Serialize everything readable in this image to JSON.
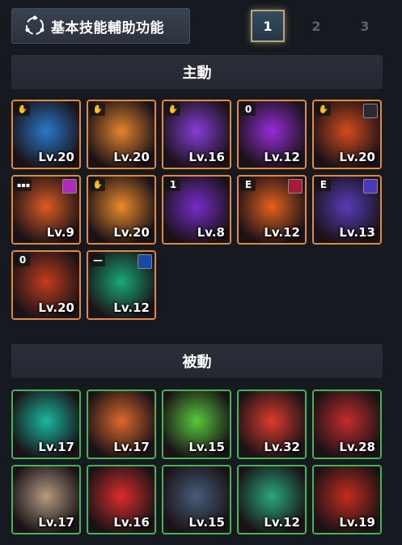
{
  "header": {
    "title": "基本技能輔助功能",
    "pages": [
      "1",
      "2",
      "3"
    ],
    "active_page": "1"
  },
  "active_section": {
    "title": "主動",
    "skills": [
      {
        "level": "Lv.20",
        "badge": "hand",
        "corner": "",
        "theme": "#2a78c8"
      },
      {
        "level": "Lv.20",
        "badge": "hand",
        "corner": "",
        "theme": "#e8842a"
      },
      {
        "level": "Lv.16",
        "badge": "hand",
        "corner": "",
        "theme": "#8a3ad8"
      },
      {
        "level": "Lv.12",
        "badge": "0",
        "corner": "",
        "theme": "#9a2ad8"
      },
      {
        "level": "Lv.20",
        "badge": "hand",
        "corner": "dark",
        "theme": "#d84a1a"
      },
      {
        "level": "Lv.9",
        "badge": "dots",
        "corner": "magenta",
        "theme": "#e05a20"
      },
      {
        "level": "Lv.20",
        "badge": "hand",
        "corner": "",
        "theme": "#f08a2a"
      },
      {
        "level": "Lv.8",
        "badge": "1",
        "corner": "",
        "theme": "#7a2ac8"
      },
      {
        "level": "Lv.12",
        "badge": "E",
        "corner": "crimson",
        "theme": "#e8601a"
      },
      {
        "level": "Lv.13",
        "badge": "E",
        "corner": "violet",
        "theme": "#5a3ab8"
      },
      {
        "level": "Lv.20",
        "badge": "0",
        "corner": "",
        "theme": "#c83a1a"
      },
      {
        "level": "Lv.12",
        "badge": "bar",
        "corner": "blue",
        "theme": "#1aa878"
      }
    ]
  },
  "passive_section": {
    "title": "被動",
    "skills": [
      {
        "level": "Lv.17",
        "theme": "#1ab8a0"
      },
      {
        "level": "Lv.17",
        "theme": "#e0682a"
      },
      {
        "level": "Lv.15",
        "theme": "#5ac83a"
      },
      {
        "level": "Lv.32",
        "theme": "#e03a2a"
      },
      {
        "level": "Lv.28",
        "theme": "#c82a2a"
      },
      {
        "level": "Lv.17",
        "theme": "#b89a80"
      },
      {
        "level": "Lv.16",
        "theme": "#e02a2a"
      },
      {
        "level": "Lv.15",
        "theme": "#4a5a78"
      },
      {
        "level": "Lv.12",
        "theme": "#2aa878"
      },
      {
        "level": "Lv.19",
        "theme": "#c82a1a"
      }
    ]
  }
}
